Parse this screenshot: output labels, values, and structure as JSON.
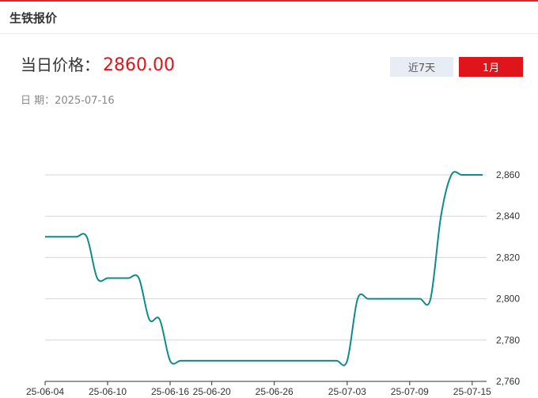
{
  "panel": {
    "title": "生铁报价"
  },
  "price": {
    "label": "当日价格：",
    "value": "2860.00"
  },
  "date": {
    "label": "日 期：",
    "value": "2025-07-16"
  },
  "range_tabs": [
    {
      "label": "近7天",
      "active": false
    },
    {
      "label": "1月",
      "active": true
    }
  ],
  "colors": {
    "accent": "#e0141b",
    "line": "#0e8b8b",
    "grid": "#d6d6d6",
    "inactive_tab": "#e8edf5"
  },
  "chart_data": {
    "type": "line",
    "title": "",
    "xlabel": "",
    "ylabel": "",
    "x": [
      "25-06-04",
      "25-06-05",
      "25-06-06",
      "25-06-07",
      "25-06-08",
      "25-06-09",
      "25-06-10",
      "25-06-11",
      "25-06-12",
      "25-06-13",
      "25-06-14",
      "25-06-15",
      "25-06-16",
      "25-06-17",
      "25-06-18",
      "25-06-19",
      "25-06-20",
      "25-06-21",
      "25-06-22",
      "25-06-23",
      "25-06-24",
      "25-06-25",
      "25-06-26",
      "25-06-27",
      "25-06-28",
      "25-06-29",
      "25-06-30",
      "25-07-01",
      "25-07-02",
      "25-07-03",
      "25-07-04",
      "25-07-05",
      "25-07-06",
      "25-07-07",
      "25-07-08",
      "25-07-09",
      "25-07-10",
      "25-07-11",
      "25-07-12",
      "25-07-13",
      "25-07-14",
      "25-07-15",
      "25-07-16"
    ],
    "x_tick_labels": [
      "25-06-04",
      "25-06-10",
      "25-06-16",
      "25-06-20",
      "25-06-26",
      "25-07-03",
      "25-07-09",
      "25-07-15"
    ],
    "series": [
      {
        "values": [
          2830,
          2830,
          2830,
          2830,
          2830,
          2810,
          2810,
          2810,
          2810,
          2810,
          2790,
          2790,
          2770,
          2770,
          2770,
          2770,
          2770,
          2770,
          2770,
          2770,
          2770,
          2770,
          2770,
          2770,
          2770,
          2770,
          2770,
          2770,
          2770,
          2770,
          2800,
          2800,
          2800,
          2800,
          2800,
          2800,
          2800,
          2800,
          2840,
          2860,
          2860,
          2860,
          2860
        ]
      }
    ],
    "y_ticks": [
      2760,
      2780,
      2800,
      2820,
      2840,
      2860
    ],
    "y_tick_labels": [
      "2,760",
      "2,780",
      "2,800",
      "2,820",
      "2,840",
      "2,860"
    ],
    "ylim": [
      2760,
      2860
    ],
    "grid": true,
    "y_axis_side": "right"
  }
}
